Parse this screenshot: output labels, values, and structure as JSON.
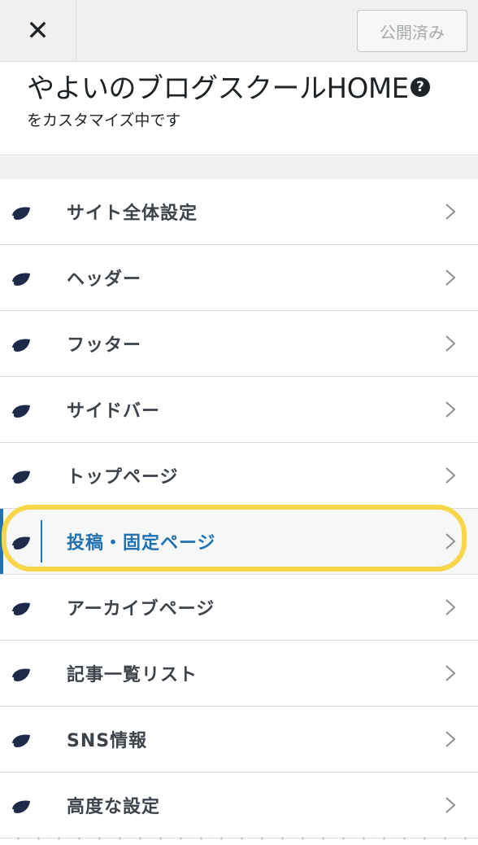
{
  "topbar": {
    "close_symbol": "✕",
    "publish_label": "公開済み"
  },
  "header": {
    "site_title": "やよいのブログスクールHOME",
    "help_symbol": "?",
    "subtitle": "をカスタマイズ中です"
  },
  "menu": {
    "items": [
      {
        "label": "サイト全体設定",
        "icon": "leaf-icon"
      },
      {
        "label": "ヘッダー",
        "icon": "leaf-icon"
      },
      {
        "label": "フッター",
        "icon": "leaf-icon"
      },
      {
        "label": "サイドバー",
        "icon": "leaf-icon"
      },
      {
        "label": "トップページ",
        "icon": "leaf-icon"
      },
      {
        "label": "投稿・固定ページ",
        "icon": "leaf-icon",
        "active": true
      },
      {
        "label": "アーカイブページ",
        "icon": "leaf-icon"
      },
      {
        "label": "記事一覧リスト",
        "icon": "leaf-icon"
      },
      {
        "label": "SNS情報",
        "icon": "leaf-icon"
      },
      {
        "label": "高度な設定",
        "icon": "leaf-icon"
      }
    ]
  },
  "colors": {
    "accent": "#2271b1",
    "highlight": "#f8d649",
    "panel_bg": "#f0f0f1",
    "text": "#3c434a"
  }
}
